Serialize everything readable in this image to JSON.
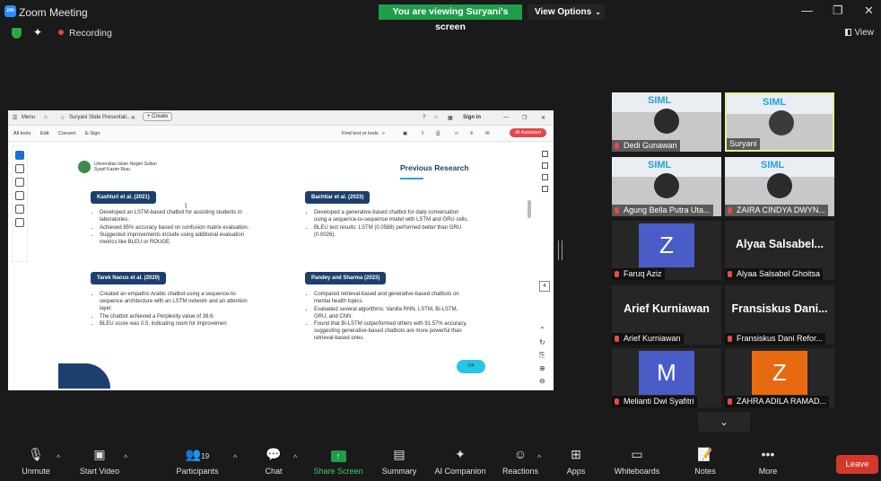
{
  "window": {
    "app_icon": "zoom",
    "title": "Zoom Meeting",
    "banner": "You are viewing Suryani's screen",
    "view_options": "View Options",
    "minimize": "—",
    "restore": "❐",
    "close": "✕"
  },
  "status": {
    "recording_label": "Recording",
    "view_label": "View"
  },
  "browser": {
    "tab_menu": "Menu",
    "tab_title": "Suryani Slide Presentati...",
    "tab_create": "+ Create",
    "sign_in": "Sign in",
    "acrobat_menu": [
      "All tools",
      "Edit",
      "Convert",
      "E-Sign"
    ],
    "find_text": "Find text or tools",
    "ai_assistant": "AI Assistant",
    "page_number": "4"
  },
  "slide": {
    "university": [
      "Universitas Islam Negeri Sultan",
      "Syarif Kasim Riau"
    ],
    "heading": "Previous Research",
    "blocks": [
      {
        "title": "Kashturi et al. (2021)",
        "bullets": [
          "Developed an LSTM-based chatbot for assisting students in laboratories.",
          "Achieved 85% accuracy based on confusion matrix evaluation.",
          "Suggested improvements include using additional evaluation metrics like BLEU or ROUGE."
        ]
      },
      {
        "title": "Bachtiar et al. (2023)",
        "bullets": [
          "Developed a generative-based chatbot for daily conversation using a sequence-to-sequence model with LSTM and GRU cells.",
          "BLEU test results: LSTM (0.0588) performed better than GRU (0.0026)."
        ]
      },
      {
        "title": "Tarek Naous et al. (2020)",
        "bullets": [
          "Created an empathic Arabic chatbot using a sequence-to-sequence architecture with an LSTM network and an attention layer.",
          "The chatbot achieved a Perplexity value of 38.6.",
          "BLEU score was 0.5, indicating room for improvemen"
        ]
      },
      {
        "title": "Pandey and Sharma (2023)",
        "bullets": [
          "Compared retrieval-based and generative-based chatbots on mental health topics.",
          "Evaluated several algorithms: Vanilla RNN, LSTM, Bi-LSTM, GRU, and CNN.",
          "Found that Bi-LSTM outperformed others with 91.57% accuracy, suggesting generative-based chatbots are more powerful than retrieval-based ones."
        ]
      }
    ],
    "cursor": "I",
    "pill": "04"
  },
  "participants": [
    {
      "name": "Dedi Gunawan",
      "kind": "video",
      "muted": true
    },
    {
      "name": "Suryani",
      "kind": "video",
      "active": true,
      "muted": false
    },
    {
      "name": "Agung Bella Putra Uta...",
      "kind": "video",
      "muted": true
    },
    {
      "name": "ZAIRA CINDYA DWYN...",
      "kind": "video",
      "muted": true
    },
    {
      "name": "Faruq Aziz",
      "kind": "avatar",
      "initial": "Z",
      "color": "#4a5dc6",
      "muted": true
    },
    {
      "name": "Alyaa Salsabel Ghoitsa",
      "kind": "text",
      "display": "Alyaa Salsabel...",
      "muted": true
    },
    {
      "name": "Arief Kurniawan",
      "kind": "text",
      "display": "Arief Kurniawan",
      "muted": true
    },
    {
      "name": "Fransiskus Dani Refor...",
      "kind": "text",
      "display": "Fransiskus Dani...",
      "muted": true
    },
    {
      "name": "Melianti Dwi Syafitri",
      "kind": "avatar",
      "initial": "M",
      "color": "#4a5dc6",
      "muted": true
    },
    {
      "name": "ZAHRA ADILA RAMAD...",
      "kind": "avatar",
      "initial": "Z",
      "color": "#e86a10",
      "muted": true
    }
  ],
  "video_banner_text": "SIML",
  "toolbar": {
    "unmute": "Unmute",
    "start_video": "Start Video",
    "participants": "Participants",
    "participants_count": "19",
    "chat": "Chat",
    "share_screen": "Share Screen",
    "summary": "Summary",
    "ai_companion": "AI Companion",
    "reactions": "Reactions",
    "apps": "Apps",
    "whiteboards": "Whiteboards",
    "notes": "Notes",
    "more": "More",
    "leave": "Leave"
  },
  "colors": {
    "banner_green": "#1e9e4b",
    "leave_red": "#d4382a",
    "slide_navy": "#1d3f6e",
    "active_border": "#e3f28c"
  }
}
